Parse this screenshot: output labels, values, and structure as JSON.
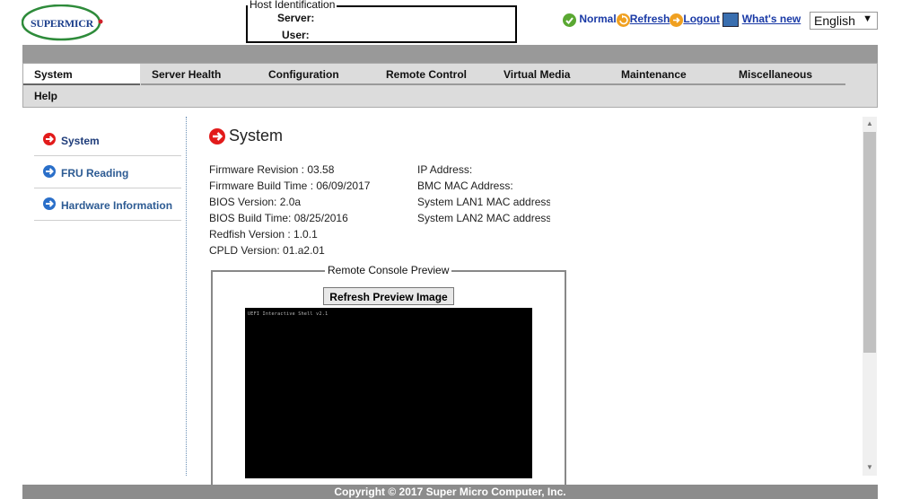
{
  "header": {
    "logo_text": "SUPERMICR",
    "host_identification": {
      "legend": "Host Identification",
      "server_label": "Server:",
      "user_label": "User:"
    },
    "status_label": "Normal",
    "links": {
      "refresh": "Refresh",
      "logout": "Logout",
      "whats_new": "What's  new"
    },
    "language": "English"
  },
  "nav": {
    "tabs": [
      {
        "label": "System"
      },
      {
        "label": "Server Health"
      },
      {
        "label": "Configuration"
      },
      {
        "label": "Remote Control"
      },
      {
        "label": "Virtual Media"
      },
      {
        "label": "Maintenance"
      },
      {
        "label": "Miscellaneous"
      },
      {
        "label": "Help"
      }
    ]
  },
  "sidebar": {
    "items": [
      {
        "label": "System"
      },
      {
        "label": "FRU Reading"
      },
      {
        "label": "Hardware Information"
      }
    ]
  },
  "main": {
    "title": "System",
    "left_info": [
      "Firmware Revision :  03.58",
      "Firmware Build Time :  06/09/2017",
      "BIOS Version: 2.0a",
      "BIOS Build Time: 08/25/2016",
      "Redfish Version : 1.0.1",
      "CPLD Version: 01.a2.01"
    ],
    "right_info": [
      "IP Address:",
      "BMC MAC Address:",
      "System LAN1 MAC address",
      "System LAN2 MAC address"
    ],
    "preview": {
      "legend": "Remote Console Preview",
      "refresh_button": "Refresh Preview Image",
      "screen_text": "UEFI Interactive Shell v2.1"
    }
  },
  "footer": {
    "copyright": "Copyright © 2017 Super Micro Computer, Inc."
  },
  "colors": {
    "link": "#1a3aa6",
    "nav_bg": "#dcdcdc",
    "logo_green": "#2e8b3a",
    "arrow_red": "#e21b1b",
    "arrow_blue": "#2a6fc9"
  }
}
